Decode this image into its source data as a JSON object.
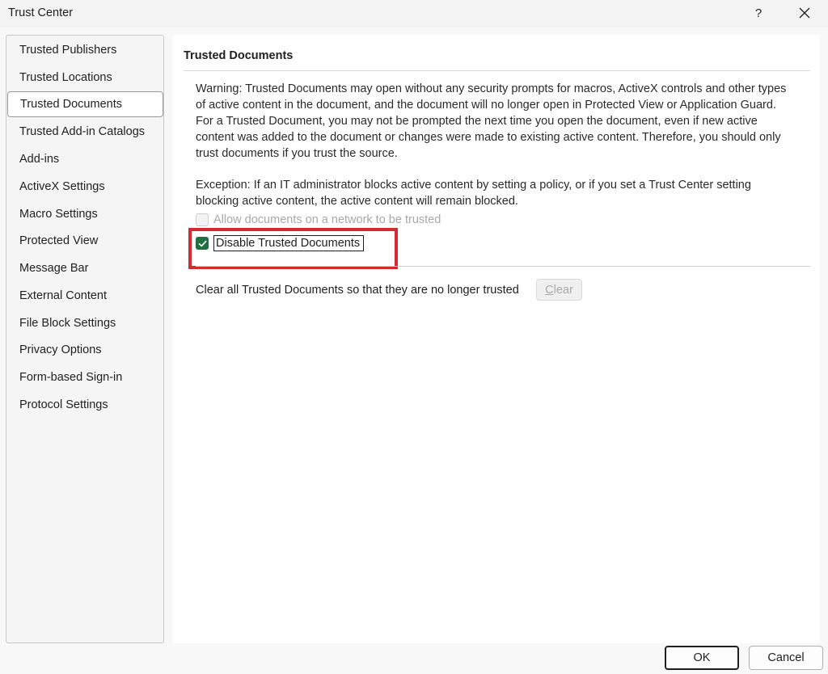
{
  "window": {
    "title": "Trust Center",
    "help_label": "?",
    "close_icon": "close-icon"
  },
  "sidebar": {
    "items": [
      {
        "label": "Trusted Publishers"
      },
      {
        "label": "Trusted Locations"
      },
      {
        "label": "Trusted Documents",
        "selected": true
      },
      {
        "label": "Trusted Add-in Catalogs"
      },
      {
        "label": "Add-ins"
      },
      {
        "label": "ActiveX Settings"
      },
      {
        "label": "Macro Settings"
      },
      {
        "label": "Protected View"
      },
      {
        "label": "Message Bar"
      },
      {
        "label": "External Content"
      },
      {
        "label": "File Block Settings"
      },
      {
        "label": "Privacy Options"
      },
      {
        "label": "Form-based Sign-in"
      },
      {
        "label": "Protocol Settings"
      }
    ]
  },
  "main": {
    "section_title": "Trusted Documents",
    "warning_text": "Warning: Trusted Documents may open without any security prompts for macros, ActiveX controls and other types of active content in the document, and the document will no longer open in Protected View or Application Guard. For a Trusted Document, you may not be prompted the next time you open the document, even if new active content was added to the document or changes were made to existing active content. Therefore, you should only trust documents if you trust the source.",
    "exception_text": "Exception: If an IT administrator blocks active content by setting a policy, or if you set a Trust Center setting blocking active content, the active content will remain blocked.",
    "allow_network": {
      "label": "Allow documents on a network to be trusted",
      "checked": false,
      "enabled": false
    },
    "disable_trusted": {
      "label": "Disable Trusted Documents",
      "checked": true,
      "enabled": true
    },
    "clear_text": "Clear all Trusted Documents so that they are no longer trusted",
    "clear_button": "Clear"
  },
  "footer": {
    "ok_label": "OK",
    "cancel_label": "Cancel"
  },
  "colors": {
    "accent_check": "#1f6f43",
    "highlight_red": "#d42a33"
  }
}
